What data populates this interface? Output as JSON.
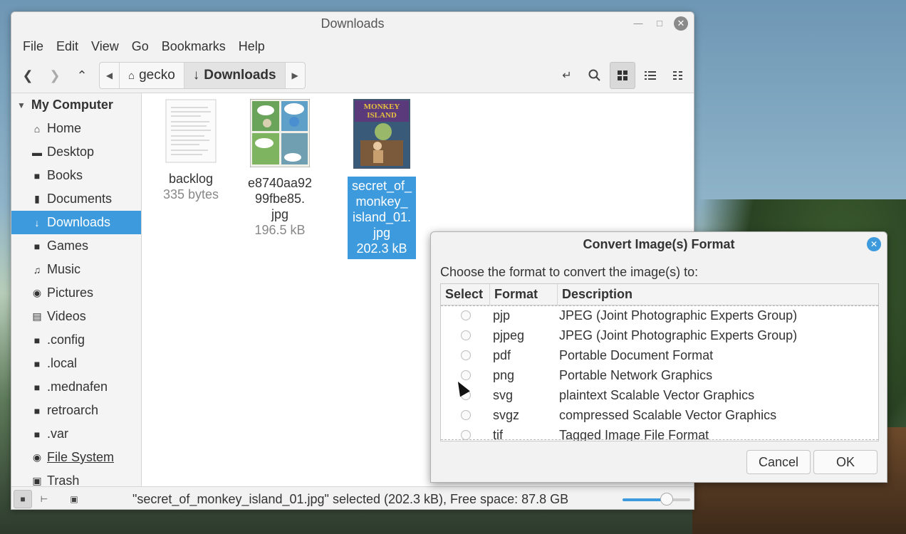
{
  "window": {
    "title": "Downloads"
  },
  "menubar": [
    "File",
    "Edit",
    "View",
    "Go",
    "Bookmarks",
    "Help"
  ],
  "breadcrumb": {
    "home": "gecko",
    "current": "Downloads"
  },
  "sidebar": {
    "header": "My Computer",
    "items": [
      {
        "label": "Home",
        "icon": "home-icon"
      },
      {
        "label": "Desktop",
        "icon": "desktop-icon"
      },
      {
        "label": "Books",
        "icon": "folder-icon"
      },
      {
        "label": "Documents",
        "icon": "document-icon"
      },
      {
        "label": "Downloads",
        "icon": "download-icon"
      },
      {
        "label": "Games",
        "icon": "folder-icon"
      },
      {
        "label": "Music",
        "icon": "music-icon"
      },
      {
        "label": "Pictures",
        "icon": "camera-icon"
      },
      {
        "label": "Videos",
        "icon": "film-icon"
      },
      {
        "label": ".config",
        "icon": "folder-icon"
      },
      {
        "label": ".local",
        "icon": "folder-icon"
      },
      {
        "label": ".mednafen",
        "icon": "folder-icon"
      },
      {
        "label": "retroarch",
        "icon": "folder-icon"
      },
      {
        "label": ".var",
        "icon": "folder-icon"
      },
      {
        "label": "File System",
        "icon": "drive-icon"
      },
      {
        "label": "Trash",
        "icon": "trash-icon"
      }
    ]
  },
  "files": [
    {
      "name": "backlog",
      "size": "335 bytes"
    },
    {
      "name_lines": [
        "e8740aa92",
        "99fbe85.",
        "jpg"
      ],
      "size": "196.5 kB"
    },
    {
      "name_lines": [
        "secret_of_",
        "monkey_",
        "island_01.",
        "jpg"
      ],
      "size": "202.3 kB",
      "thumb_text": [
        "MONKEY",
        "ISLAND"
      ]
    }
  ],
  "status": {
    "text": "\"secret_of_monkey_island_01.jpg\" selected (202.3 kB), Free space: 87.8 GB",
    "zoom_fraction": 0.65
  },
  "dialog": {
    "title": "Convert Image(s) Format",
    "prompt": "Choose the format to convert the image(s) to:",
    "columns": [
      "Select",
      "Format",
      "Description"
    ],
    "rows": [
      {
        "format": "pjp",
        "description": "JPEG (Joint Photographic Experts Group)"
      },
      {
        "format": "pjpeg",
        "description": "JPEG (Joint Photographic Experts Group)"
      },
      {
        "format": "pdf",
        "description": "Portable Document Format"
      },
      {
        "format": "png",
        "description": "Portable Network Graphics"
      },
      {
        "format": "svg",
        "description": "plaintext Scalable Vector Graphics"
      },
      {
        "format": "svgz",
        "description": "compressed Scalable Vector Graphics"
      },
      {
        "format": "tif",
        "description": "Tagged Image File Format"
      }
    ],
    "cancel": "Cancel",
    "ok": "OK"
  },
  "colors": {
    "accent": "#3d9adc"
  }
}
